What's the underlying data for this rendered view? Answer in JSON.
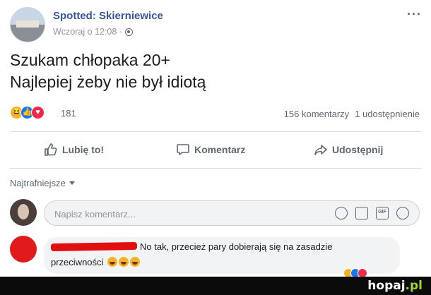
{
  "post": {
    "page_name": "Spotted: Skierniewice",
    "timestamp": "Wczoraj o 12:08 ·",
    "more_label": "···",
    "text_line1": "Szukam chłopaka 20+",
    "text_line2": "Najlepiej żeby nie był idiotą",
    "reaction_icons": [
      "haha",
      "like",
      "love"
    ],
    "reaction_count": "181",
    "comments_count": "156 komentarzy",
    "shares_count": "1 udostępnienie"
  },
  "actions": {
    "like": "Lubię to!",
    "comment": "Komentarz",
    "share": "Udostępnij"
  },
  "comments": {
    "sort_label": "Najtrafniejsze",
    "input_placeholder": "Napisz komentarz...",
    "input_icons": [
      "smile-icon",
      "camera-icon",
      "gif-icon",
      "sticker-icon"
    ],
    "gif_label": "GIF",
    "first_comment": {
      "author_redacted": true,
      "text_line1": "No tak, przecież pary dobierają się na zasadzie",
      "text_line2": "przeciwności"
    }
  },
  "watermark": {
    "brand": "hopaj",
    "tld": ".pl"
  },
  "colors": {
    "link_blue": "#365899",
    "like_blue": "#1877f2",
    "love_red": "#f0284a",
    "haha_yellow": "#f7b125",
    "watermark_green": "#9fd534"
  }
}
